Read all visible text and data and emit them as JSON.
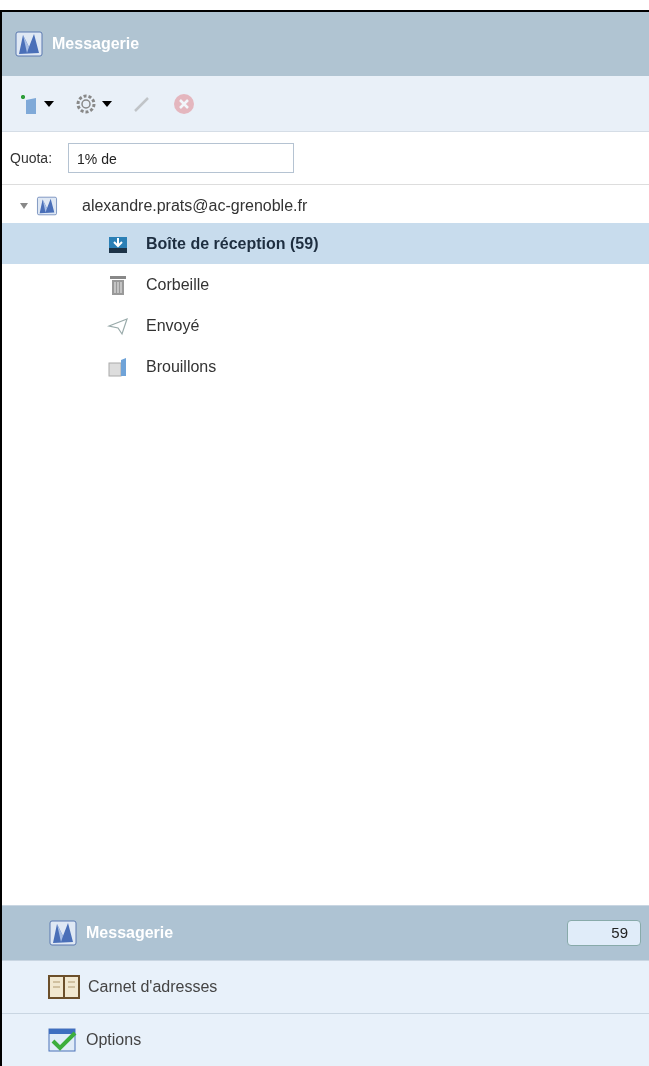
{
  "header": {
    "title": "Messagerie"
  },
  "toolbar": [
    {
      "kind": "new-folder",
      "menu": true,
      "disabled": false
    },
    {
      "kind": "settings",
      "menu": true,
      "disabled": false
    },
    {
      "kind": "edit",
      "menu": false,
      "disabled": true
    },
    {
      "kind": "delete",
      "menu": false,
      "disabled": true
    }
  ],
  "quota": {
    "label": "Quota:",
    "value": "1% de"
  },
  "account": {
    "name": "alexandre.prats@ac-grenoble.fr",
    "expanded": true,
    "children": [
      {
        "kind": "inbox",
        "label": "Boîte de réception (59)",
        "selected": true
      },
      {
        "kind": "trash",
        "label": "Corbeille",
        "selected": false
      },
      {
        "kind": "sent",
        "label": "Envoyé",
        "selected": false
      },
      {
        "kind": "drafts",
        "label": "Brouillons",
        "selected": false
      }
    ]
  },
  "nav": [
    {
      "kind": "mail",
      "label": "Messagerie",
      "badge": "59",
      "selected": true
    },
    {
      "kind": "contacts",
      "label": "Carnet d'adresses",
      "selected": false
    },
    {
      "kind": "options",
      "label": "Options",
      "selected": false
    }
  ]
}
